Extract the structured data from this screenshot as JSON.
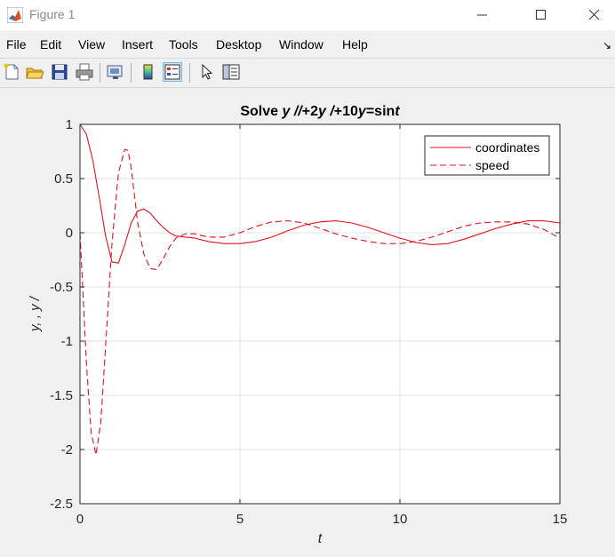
{
  "window": {
    "title": "Figure 1",
    "minimize_glyph": "—",
    "maximize_glyph": "☐",
    "close_glyph": "✕"
  },
  "menu": {
    "items": [
      "File",
      "Edit",
      "View",
      "Insert",
      "Tools",
      "Desktop",
      "Window",
      "Help"
    ],
    "dock_glyph": "↘"
  },
  "toolbar": {
    "buttons": [
      "new-figure-icon",
      "open-file-icon",
      "save-icon",
      "print-icon",
      "link-plot-icon",
      "colorbar-icon",
      "legend-icon",
      "pointer-icon",
      "property-editor-icon"
    ]
  },
  "colors": {
    "series": "#e8101a",
    "grid": "#e1e1e1",
    "axes_box": "#262626"
  },
  "chart_data": {
    "type": "line",
    "title_parts": [
      {
        "text": "Solve ",
        "italic": false
      },
      {
        "text": "y ",
        "italic": true
      },
      {
        "text": "//",
        "italic": true
      },
      {
        "text": "+2",
        "italic": false
      },
      {
        "text": "y ",
        "italic": true
      },
      {
        "text": "/",
        "italic": true
      },
      {
        "text": "+10",
        "italic": false
      },
      {
        "text": "y",
        "italic": true
      },
      {
        "text": "=sin",
        "italic": false
      },
      {
        "text": "t",
        "italic": true
      }
    ],
    "xlabel": "t",
    "ylabel": "y, , y /",
    "xlim": [
      0,
      15
    ],
    "ylim": [
      -2.5,
      1
    ],
    "xticks": [
      0,
      5,
      10,
      15
    ],
    "xtick_labels": [
      "0",
      "5",
      "10",
      "15"
    ],
    "yticks": [
      -2.5,
      -2,
      -1.5,
      -1,
      -0.5,
      0,
      0.5,
      1
    ],
    "ytick_labels": [
      "-2.5",
      "-2",
      "-1.5",
      "-1",
      "-0.5",
      "0",
      "0.5",
      "1"
    ],
    "grid": true,
    "legend_position": "top-right",
    "series": [
      {
        "name": "coordinates",
        "style": "solid",
        "x": [
          0,
          0.2,
          0.4,
          0.6,
          0.8,
          1.0,
          1.2,
          1.4,
          1.6,
          1.8,
          2.0,
          2.2,
          2.4,
          2.6,
          2.8,
          3.0,
          3.3,
          3.6,
          4.0,
          4.5,
          5.0,
          5.5,
          6.0,
          6.5,
          7.0,
          7.5,
          8.0,
          8.5,
          9.0,
          9.5,
          10.0,
          10.5,
          11.0,
          11.5,
          12.0,
          12.5,
          13.0,
          13.5,
          14.0,
          14.5,
          15.0
        ],
        "y": [
          1,
          0.91,
          0.67,
          0.33,
          -0.03,
          -0.27,
          -0.28,
          -0.11,
          0.09,
          0.2,
          0.22,
          0.18,
          0.11,
          0.05,
          0.0,
          -0.03,
          -0.04,
          -0.05,
          -0.08,
          -0.1,
          -0.1,
          -0.08,
          -0.04,
          0.02,
          0.07,
          0.1,
          0.11,
          0.09,
          0.05,
          0.0,
          -0.05,
          -0.09,
          -0.11,
          -0.1,
          -0.06,
          -0.01,
          0.04,
          0.08,
          0.11,
          0.11,
          0.09
        ]
      },
      {
        "name": "speed",
        "style": "dashed",
        "x": [
          0,
          0.1,
          0.2,
          0.35,
          0.5,
          0.65,
          0.8,
          1.0,
          1.2,
          1.4,
          1.5,
          1.6,
          1.8,
          2.0,
          2.2,
          2.4,
          2.6,
          2.8,
          3.0,
          3.3,
          3.6,
          4.0,
          4.5,
          5.0,
          5.5,
          6.0,
          6.5,
          7.0,
          7.5,
          8.0,
          8.5,
          9.0,
          9.5,
          10.0,
          10.5,
          11.0,
          11.5,
          12.0,
          12.5,
          13.0,
          13.5,
          14.0,
          14.5,
          15.0
        ],
        "y": [
          0,
          -0.6,
          -1.2,
          -1.85,
          -2.05,
          -1.75,
          -1.05,
          -0.1,
          0.55,
          0.77,
          0.76,
          0.6,
          0.1,
          -0.2,
          -0.33,
          -0.34,
          -0.24,
          -0.13,
          -0.05,
          -0.01,
          -0.01,
          -0.04,
          -0.04,
          0.0,
          0.06,
          0.1,
          0.11,
          0.09,
          0.04,
          -0.01,
          -0.05,
          -0.08,
          -0.1,
          -0.1,
          -0.08,
          -0.04,
          0.01,
          0.06,
          0.09,
          0.1,
          0.1,
          0.08,
          0.03,
          -0.05
        ]
      }
    ]
  }
}
